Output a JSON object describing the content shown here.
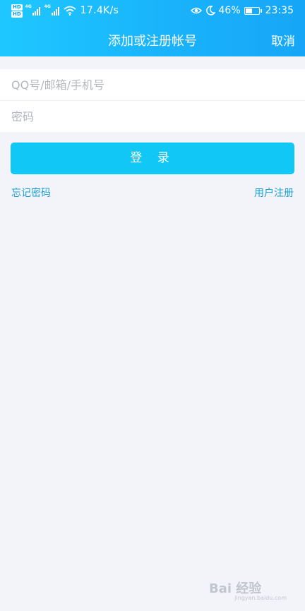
{
  "status_bar": {
    "hd_badges": [
      "HD",
      "HD"
    ],
    "network_labels": [
      "4G",
      "4G"
    ],
    "speed": "17.4K/s",
    "battery": "46%",
    "battery_level": 0.46,
    "time": "23:35",
    "icons": [
      "eye-comfort-icon",
      "moon-icon",
      "wifi-icon",
      "signal-icon",
      "battery-icon"
    ]
  },
  "header": {
    "title": "添加或注册帐号",
    "cancel_label": "取消",
    "gradient_colors": [
      "#1ec8ff",
      "#17a6f7"
    ]
  },
  "form": {
    "account_placeholder": "QQ号/邮箱/手机号",
    "account_value": "",
    "password_placeholder": "密码",
    "password_value": ""
  },
  "login_button": {
    "label": "登 录",
    "color": "#11c7f6"
  },
  "links": {
    "forgot_password": "忘记密码",
    "register": "用户注册",
    "color": "#1aa1d6"
  },
  "watermark": {
    "brand": "Bai 经验",
    "url": "jingyan.baidu.com"
  }
}
